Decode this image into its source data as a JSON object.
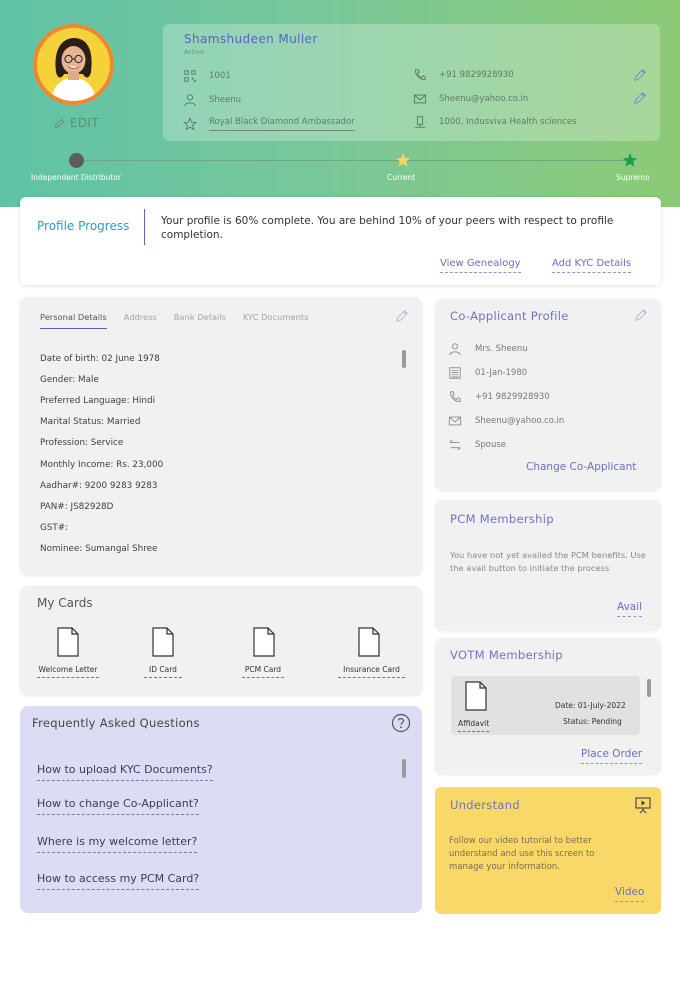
{
  "header": {
    "edit_label": "EDIT",
    "user": {
      "name": "Shamshudeen Muller",
      "status": "Active",
      "id": "1001",
      "sponsor": "Sheenu",
      "rank": "Royal Black Diamond Ambassador",
      "phone": "+91 9829928930",
      "email": "Sheenu@yahoo.co.in",
      "company": "1000, Indusviva Health sciences"
    },
    "tracker": {
      "start_label": "Independent Distributor",
      "current_label": "Current",
      "end_label": "Supremo"
    }
  },
  "progress": {
    "title": "Profile Progress",
    "text": "Your profile is 60% complete. You are behind 10% of your peers with respect to profile completion.",
    "view_genealogy": "View Genealogy",
    "add_kyc": "Add KYC Details"
  },
  "personal": {
    "tabs": [
      "Personal Details",
      "Address",
      "Bank Details",
      "KYC Documents"
    ],
    "rows": [
      "Date of birth:  02 June 1978",
      "Gender: Male",
      "Preferred Language: Hindi",
      "Marital Status: Married",
      "Profession: Service",
      "Monthly Income: Rs. 23,000",
      "Aadhar#:  9200 9283 9283",
      "PAN#: JS82928D",
      "GST#:",
      "Nominee: Sumangal Shree"
    ]
  },
  "co_applicant": {
    "title": "Co-Applicant  Profile",
    "name": "Mrs. Sheenu",
    "dob": "01-Jan-1980",
    "phone": "+91 9829928930",
    "email": "Sheenu@yahoo.co.in",
    "relation": "Spouse",
    "change_label": "Change Co-Applicant"
  },
  "cards": {
    "title": "My Cards",
    "items": [
      "Welcome  Letter",
      "ID Card",
      "PCM Card",
      "Insurance  Card"
    ]
  },
  "pcm": {
    "title": "PCM Membership",
    "text": "You have not yet availed the PCM benefits. Use the avail button to initiate the process",
    "avail_label": "Avail"
  },
  "votm": {
    "title": "VOTM Membership",
    "doc_label": "Affidavit",
    "date": "Date: 01-July-2022",
    "status": "Status: Pending",
    "place_order": "Place Order"
  },
  "faq": {
    "title": "Frequently  Asked  Questions",
    "questions": [
      "How to upload KYC Documents?",
      "How to change Co-Applicant?",
      "Where is my welcome letter?",
      "How to access my PCM Card?"
    ]
  },
  "understand": {
    "title": "Understand",
    "text": "Follow our video tutorial to better understand and use this screen to manage your information.",
    "video_label": "Video"
  },
  "colors": {
    "accent": "#6a6fc0",
    "header_start": "#5ec3a6",
    "header_end": "#8cca76",
    "faq_bg": "#dcdcf4",
    "understand_bg": "#f8d868"
  }
}
